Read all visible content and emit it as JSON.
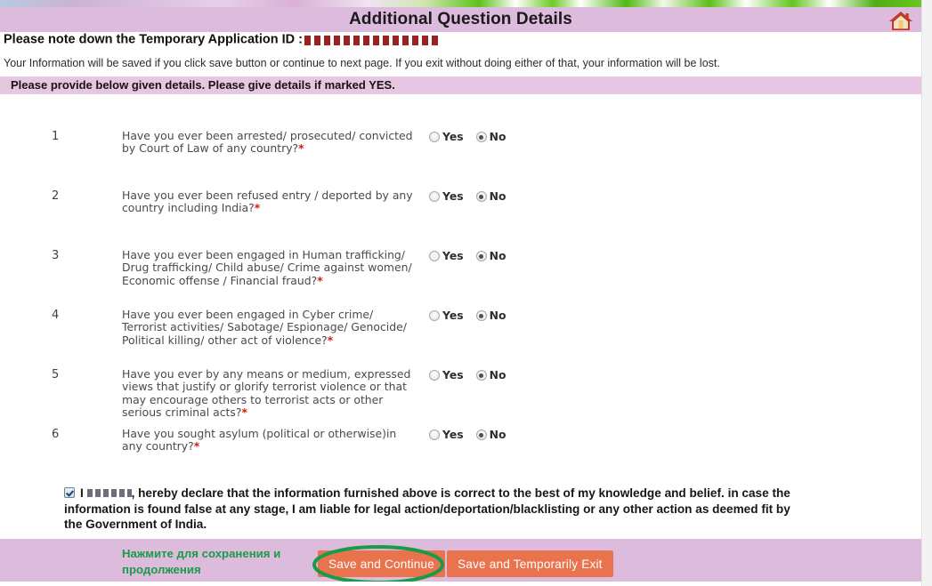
{
  "header": {
    "title": "Additional Question Details",
    "home_icon": "home-icon"
  },
  "temp_application": {
    "label": "Please note down the Temporary Application ID :",
    "value": "",
    "redacted": true
  },
  "info_note": "Your Information will be saved if you click save button or continue to next page. If you exit without doing either of that, your information will be lost.",
  "instruction_band": "Please provide below given details. Please give details if marked YES.",
  "options": {
    "yes_label": "Yes",
    "no_label": "No"
  },
  "questions": [
    {
      "number": "1",
      "text": "Have you ever been arrested/ prosecuted/ convicted by Court of Law of any country?",
      "required_mark": "*",
      "selected": "No"
    },
    {
      "number": "2",
      "text": "Have you ever been refused entry / deported by any country including India?",
      "required_mark": "*",
      "selected": "No"
    },
    {
      "number": "3",
      "text": "Have you ever been engaged in Human trafficking/ Drug trafficking/ Child abuse/ Crime against women/ Economic offense / Financial fraud?",
      "required_mark": "*",
      "selected": "No"
    },
    {
      "number": "4",
      "text": "Have you ever been engaged in Cyber crime/ Terrorist activities/ Sabotage/ Espionage/ Genocide/ Political killing/ other act of violence?",
      "required_mark": "*",
      "selected": "No"
    },
    {
      "number": "5",
      "text": "Have you ever by any means or medium, expressed views that justify or glorify terrorist violence or that may encourage others to terrorist acts or other serious criminal acts?",
      "required_mark": "*",
      "selected": "No"
    },
    {
      "number": "6",
      "text": "Have you sought asylum (political or otherwise)in any country?",
      "required_mark": "*",
      "selected": "No"
    }
  ],
  "declaration": {
    "checked": true,
    "prefix": "I ",
    "name": "",
    "text": ", hereby declare that the information furnished above is correct to the best of my knowledge and belief. in case the information is found false at any stage, I am liable for legal action/deportation/blacklisting or any other action as deemed fit by the Government of India."
  },
  "footer": {
    "annotation_text": "Нажмите для сохранения и продолжения",
    "save_continue_label": "Save and Continue",
    "save_exit_label": "Save and Temporarily Exit"
  },
  "colors": {
    "title_band": "#ddbbdd",
    "instruction_band": "#e6c6e0",
    "footer_band": "#ddbbdd",
    "button": "#e8734d",
    "annotation_green": "#199b48",
    "required_red": "#cc2200"
  }
}
